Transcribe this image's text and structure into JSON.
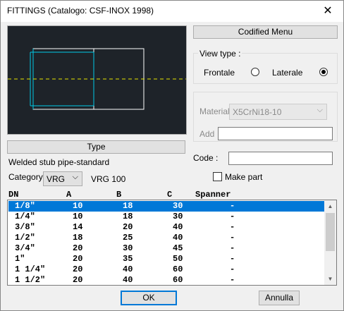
{
  "window": {
    "title": "FITTINGS (Catalogo: CSF-INOX 1998)",
    "close_glyph": "✕"
  },
  "preview": {
    "bg": "#1e2329",
    "outline_color": "#ffffff",
    "inner_color": "#00c8e6",
    "axis_color": "#e6e600"
  },
  "type_button": "Type",
  "description": "Welded stub pipe-standard",
  "category": {
    "label": "Category",
    "value": "VRG",
    "extra": "VRG 100"
  },
  "codified_menu_button": "Codified Menu",
  "view_type": {
    "label": "View type  :",
    "options": [
      {
        "label": "Frontale",
        "selected": false
      },
      {
        "label": "Laterale",
        "selected": true
      }
    ]
  },
  "material": {
    "label": "Material",
    "value": "X5CrNi18-10",
    "add_label": "Add",
    "add_value": ""
  },
  "code": {
    "label": "Code   :",
    "value": ""
  },
  "make_part": {
    "label": "Make part",
    "checked": false
  },
  "table": {
    "columns": [
      "DN",
      "A",
      "B",
      "C",
      "Spanner"
    ],
    "rows": [
      [
        "1/8\"",
        "10",
        "18",
        "30",
        "-"
      ],
      [
        "1/4\"",
        "10",
        "18",
        "30",
        "-"
      ],
      [
        "3/8\"",
        "14",
        "20",
        "40",
        "-"
      ],
      [
        "1/2\"",
        "18",
        "25",
        "40",
        "-"
      ],
      [
        "3/4\"",
        "20",
        "30",
        "45",
        "-"
      ],
      [
        "1\"",
        "20",
        "35",
        "50",
        "-"
      ],
      [
        "1 1/4\"",
        "20",
        "40",
        "60",
        "-"
      ],
      [
        "1 1/2\"",
        "20",
        "40",
        "60",
        "-"
      ]
    ],
    "selected_row": 0
  },
  "buttons": {
    "ok": "OK",
    "cancel": "Annulla"
  },
  "colors": {
    "accent": "#0078d7"
  }
}
